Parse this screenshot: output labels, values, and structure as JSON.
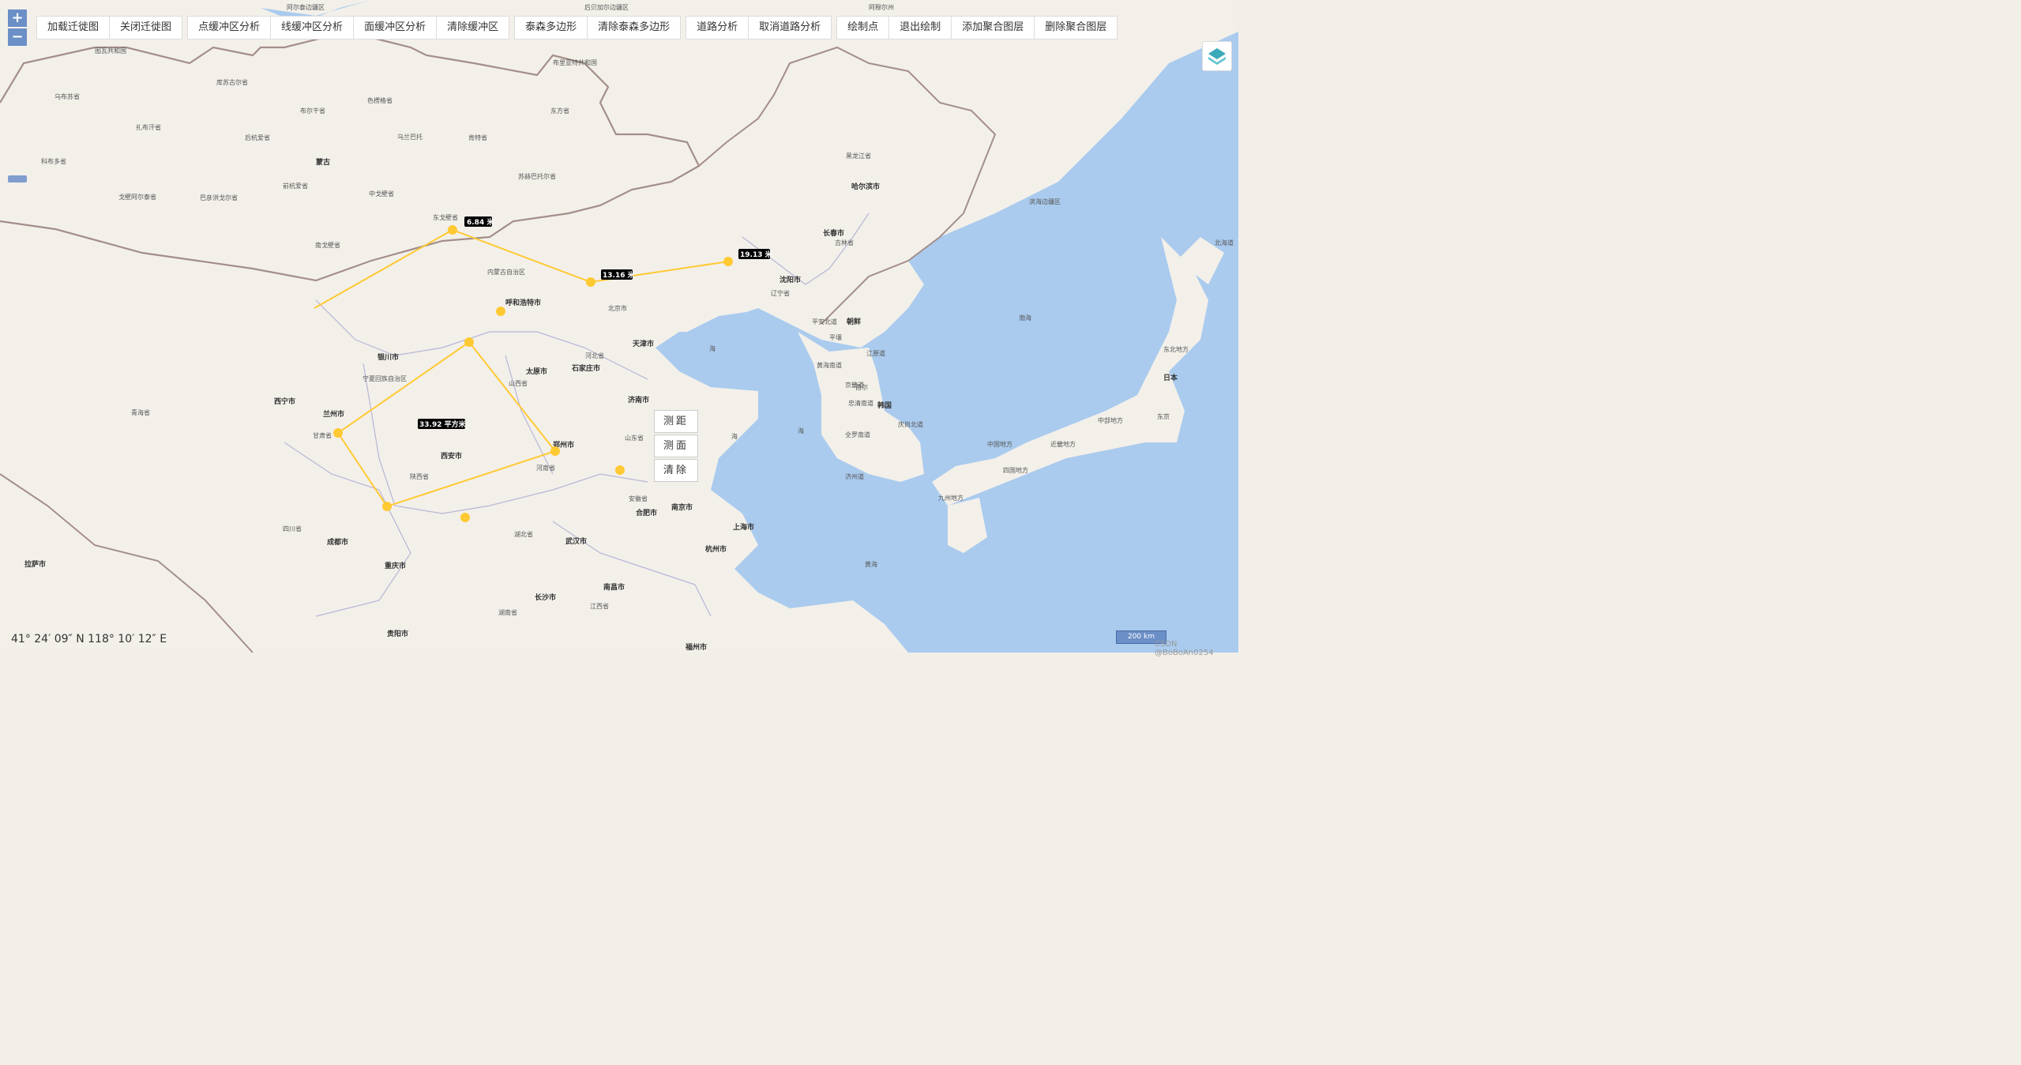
{
  "toolbar": {
    "groups": [
      [
        "加载迁徙图",
        "关闭迁徙图"
      ],
      [
        "点缓冲区分析",
        "线缓冲区分析",
        "面缓冲区分析",
        "清除缓冲区"
      ],
      [
        "泰森多边形",
        "清除泰森多边形"
      ],
      [
        "道路分析",
        "取消道路分析"
      ],
      [
        "绘制点",
        "退出绘制",
        "添加聚合图层",
        "删除聚合图层"
      ]
    ]
  },
  "zoom": {
    "in": "+",
    "out": "−"
  },
  "measure_panel": {
    "distance": "测距",
    "area": "测面",
    "clear": "清除"
  },
  "measurements": {
    "line_labels": [
      "6.84 米",
      "13.16 米",
      "19.13 米"
    ],
    "area_label": "33.92 平方米"
  },
  "coordinate_readout": "41° 24′ 09″ N 118° 10′ 12″ E",
  "scale_bar": "200 km",
  "credit": "CSDN @BoBoAn0254",
  "map_labels": {
    "countries": [
      "蒙古",
      "朝鲜",
      "韩国",
      "日本"
    ],
    "cities": [
      "呼和浩特市",
      "北京市",
      "天津市",
      "石家庄市",
      "太原市",
      "银川市",
      "兰州市",
      "西宁市",
      "西安市",
      "郑州市",
      "济南市",
      "沈阳市",
      "长春市",
      "哈尔滨市",
      "南京市",
      "合肥市",
      "上海市",
      "杭州市",
      "武汉市",
      "成都市",
      "重庆市",
      "长沙市",
      "南昌市",
      "贵阳市",
      "拉萨市",
      "福州市"
    ],
    "regions": [
      "库苏古尔省",
      "色楞格省",
      "布尔干省",
      "后杭爱省",
      "前杭爱省",
      "中戈壁省",
      "东戈壁省",
      "南戈壁省",
      "肯特省",
      "东方省",
      "苏赫巴托尔省",
      "巴彦洪戈尔省",
      "戈壁阿尔泰省",
      "扎布汗省",
      "科布多省",
      "乌布苏省",
      "图瓦共和国",
      "内蒙古自治区",
      "宁夏回族自治区",
      "甘肃省",
      "陕西省",
      "山西省",
      "河北省",
      "河南省",
      "山东省",
      "安徽省",
      "湖北省",
      "湖南省",
      "四川省",
      "青海省",
      "江西省",
      "黑龙江省",
      "吉林省",
      "辽宁省",
      "滨海边疆区",
      "北海道",
      "东北地方",
      "中部地方",
      "近畿地方",
      "中国地方",
      "四国地方",
      "九州地方",
      "平安北道",
      "江原道",
      "京畿道",
      "忠清南道",
      "全罗南道",
      "庆尚北道",
      "黄海南道",
      "济州道",
      "阿尔泰边疆区",
      "布里亚特共和国",
      "阿穆尔州",
      "后贝加尔边疆区",
      "乌兰巴托",
      "首尔",
      "平壤",
      "东京"
    ],
    "water": [
      "海",
      "海",
      "海",
      "渤海",
      "黄海"
    ]
  }
}
